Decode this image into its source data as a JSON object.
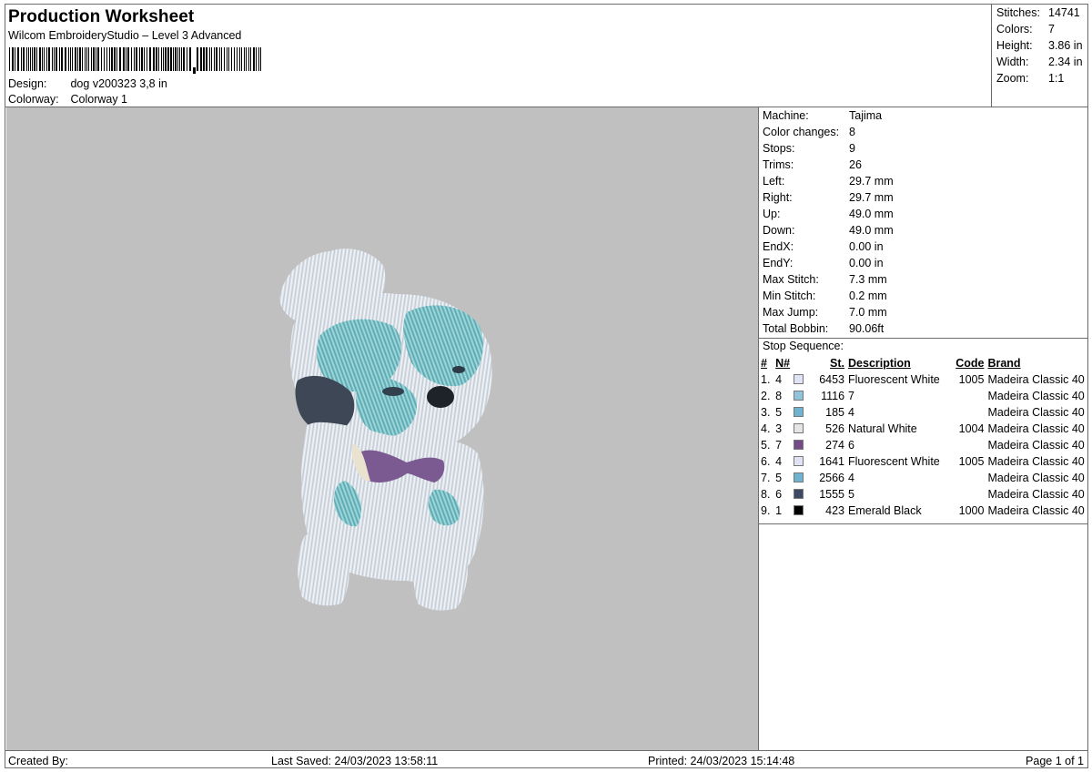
{
  "header": {
    "title": "Production Worksheet",
    "software": "Wilcom EmbroideryStudio – Level 3 Advanced",
    "design_label": "Design:",
    "design_value": "dog v200323 3,8 in",
    "colorway_label": "Colorway:",
    "colorway_value": "Colorway 1"
  },
  "stats": [
    {
      "label": "Stitches:",
      "value": "14741"
    },
    {
      "label": "Colors:",
      "value": "7"
    },
    {
      "label": "Height:",
      "value": "3.86 in"
    },
    {
      "label": "Width:",
      "value": "2.34 in"
    },
    {
      "label": "Zoom:",
      "value": "1:1"
    }
  ],
  "machine": [
    {
      "label": "Machine:",
      "value": "Tajima"
    },
    {
      "label": "Color changes:",
      "value": "8"
    },
    {
      "label": "Stops:",
      "value": "9"
    },
    {
      "label": "Trims:",
      "value": "26"
    },
    {
      "label": "Left:",
      "value": "29.7 mm"
    },
    {
      "label": "Right:",
      "value": "29.7 mm"
    },
    {
      "label": "Up:",
      "value": "49.0 mm"
    },
    {
      "label": "Down:",
      "value": "49.0 mm"
    },
    {
      "label": "EndX:",
      "value": "0.00 in"
    },
    {
      "label": "EndY:",
      "value": "0.00 in"
    },
    {
      "label": "Max Stitch:",
      "value": "7.3 mm"
    },
    {
      "label": "Min Stitch:",
      "value": "0.2 mm"
    },
    {
      "label": "Max Jump:",
      "value": "7.0 mm"
    },
    {
      "label": "Total Bobbin:",
      "value": "90.06ft"
    }
  ],
  "stop_sequence": {
    "title": "Stop Sequence:",
    "columns": {
      "idx": "#",
      "n": "N#",
      "st": "St.",
      "desc": "Description",
      "code": "Code",
      "brand": "Brand"
    },
    "rows": [
      {
        "idx": "1.",
        "n": "4",
        "color": "#dfe3f5",
        "st": "6453",
        "desc": "Fluorescent White",
        "code": "1005",
        "brand": "Madeira Classic 40"
      },
      {
        "idx": "2.",
        "n": "8",
        "color": "#8fc4dc",
        "st": "1116",
        "desc": "7",
        "code": "",
        "brand": "Madeira Classic 40"
      },
      {
        "idx": "3.",
        "n": "5",
        "color": "#6eb3cf",
        "st": "185",
        "desc": "4",
        "code": "",
        "brand": "Madeira Classic 40"
      },
      {
        "idx": "4.",
        "n": "3",
        "color": "#e7e4e7",
        "st": "526",
        "desc": "Natural White",
        "code": "1004",
        "brand": "Madeira Classic 40"
      },
      {
        "idx": "5.",
        "n": "7",
        "color": "#764a86",
        "st": "274",
        "desc": "6",
        "code": "",
        "brand": "Madeira Classic 40"
      },
      {
        "idx": "6.",
        "n": "4",
        "color": "#dfe3f5",
        "st": "1641",
        "desc": "Fluorescent White",
        "code": "1005",
        "brand": "Madeira Classic 40"
      },
      {
        "idx": "7.",
        "n": "5",
        "color": "#6eb3cf",
        "st": "2566",
        "desc": "4",
        "code": "",
        "brand": "Madeira Classic 40"
      },
      {
        "idx": "8.",
        "n": "6",
        "color": "#3d4a66",
        "st": "1555",
        "desc": "5",
        "code": "",
        "brand": "Madeira Classic 40"
      },
      {
        "idx": "9.",
        "n": "1",
        "color": "#000000",
        "st": "423",
        "desc": "Emerald Black",
        "code": "1000",
        "brand": "Madeira Classic 40"
      }
    ]
  },
  "footer": {
    "created_by": "Created By:",
    "last_saved": "Last Saved: 24/03/2023 13:58:11",
    "printed": "Printed: 24/03/2023 15:14:48",
    "page": "Page 1 of 1"
  },
  "colors": {
    "canvas_background": "#c0c0c0",
    "border": "#6b6b6b"
  }
}
